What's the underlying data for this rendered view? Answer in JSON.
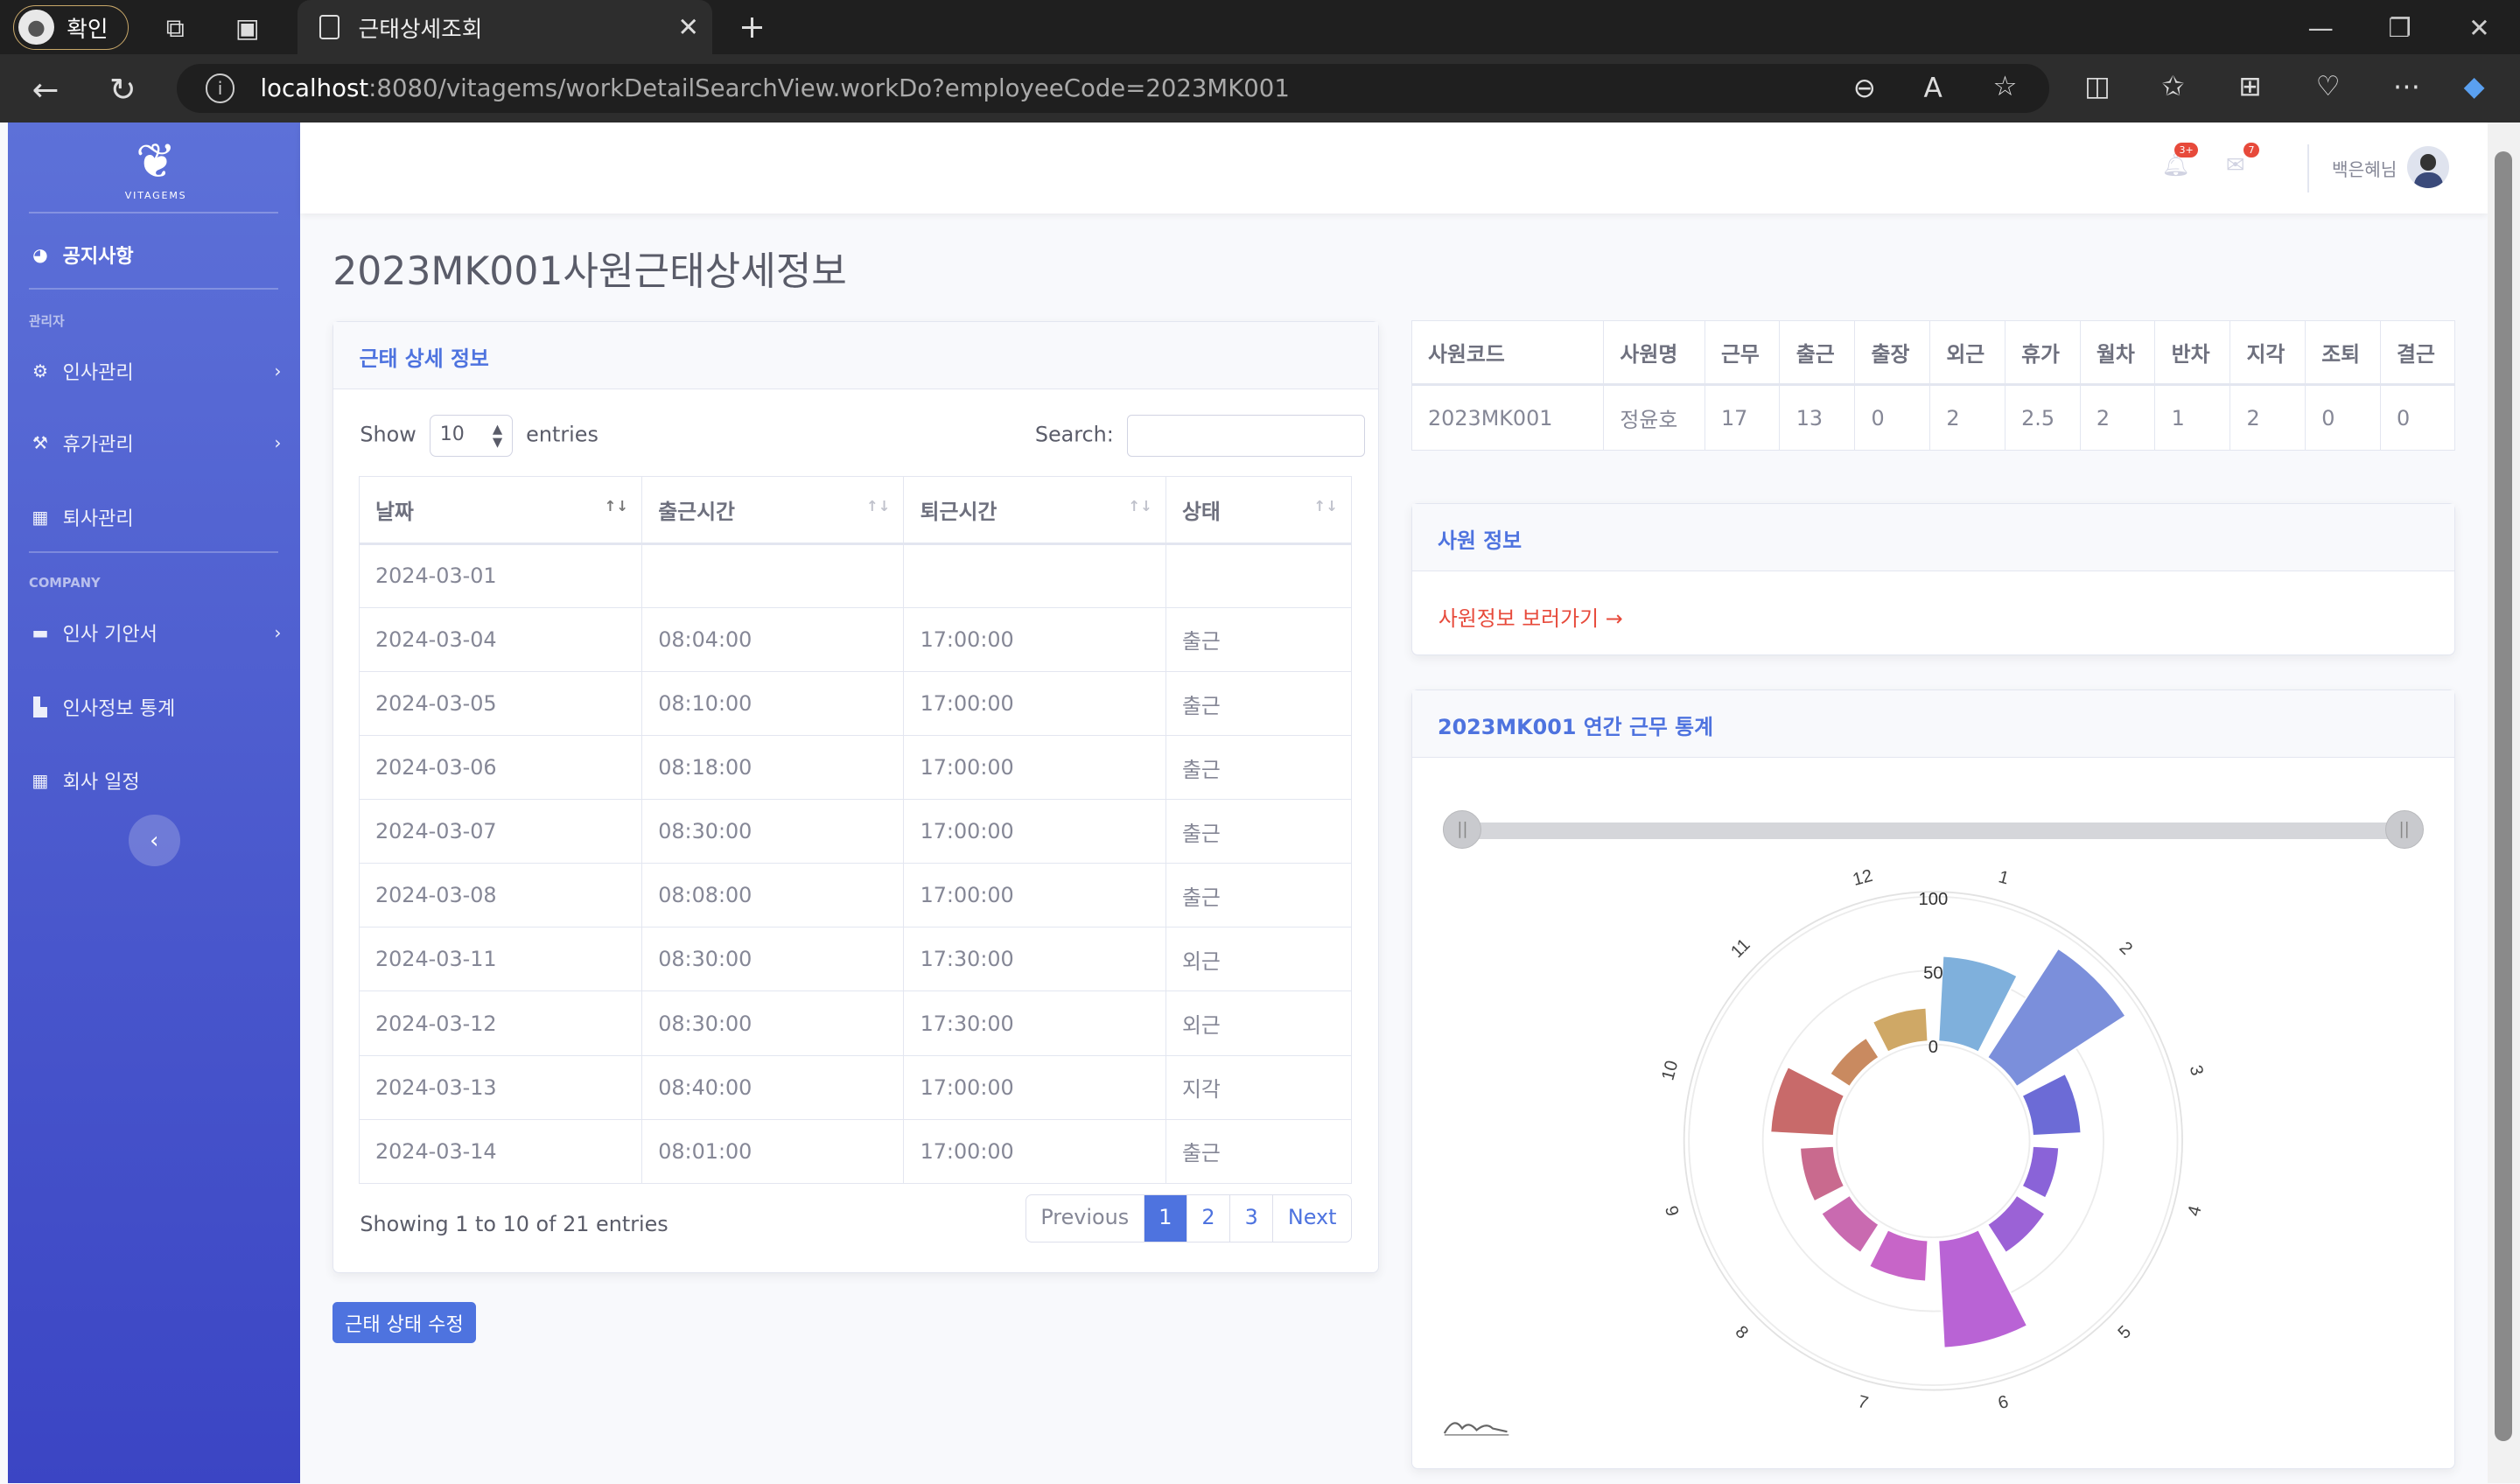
{
  "browser": {
    "profile_label": "확인",
    "tab_title": "근태상세조회",
    "url_host": "localhost",
    "url_rest": ":8080/vitagems/workDetailSearchView.workDo?employeeCode=2023MK001"
  },
  "sidebar": {
    "logo_text": "VITAGEMS",
    "items": [
      {
        "label": "공지사항",
        "icon": "dashboard-icon"
      },
      {
        "label": "인사관리",
        "icon": "gear-icon"
      },
      {
        "label": "휴가관리",
        "icon": "wrench-icon"
      },
      {
        "label": "퇴사관리",
        "icon": "table-icon"
      },
      {
        "label": "인사 기안서",
        "icon": "folder-icon"
      },
      {
        "label": "인사정보 통계",
        "icon": "chart-icon"
      },
      {
        "label": "회사 일정",
        "icon": "table-icon"
      }
    ],
    "section_admin": "관리자",
    "section_company": "COMPANY"
  },
  "topbar": {
    "alerts_badge": "3+",
    "messages_badge": "7",
    "user_name": "백은혜님"
  },
  "page_title": "2023MK001사원근태상세정보",
  "detail_card": {
    "header": "근태 상세 정보",
    "show_label": "Show",
    "entries_value": "10",
    "entries_label": "entries",
    "search_label": "Search:",
    "columns": [
      "날짜",
      "출근시간",
      "퇴근시간",
      "상태"
    ],
    "rows": [
      [
        "2024-03-01",
        "",
        "",
        ""
      ],
      [
        "2024-03-04",
        "08:04:00",
        "17:00:00",
        "출근"
      ],
      [
        "2024-03-05",
        "08:10:00",
        "17:00:00",
        "출근"
      ],
      [
        "2024-03-06",
        "08:18:00",
        "17:00:00",
        "출근"
      ],
      [
        "2024-03-07",
        "08:30:00",
        "17:00:00",
        "출근"
      ],
      [
        "2024-03-08",
        "08:08:00",
        "17:00:00",
        "출근"
      ],
      [
        "2024-03-11",
        "08:30:00",
        "17:30:00",
        "외근"
      ],
      [
        "2024-03-12",
        "08:30:00",
        "17:30:00",
        "외근"
      ],
      [
        "2024-03-13",
        "08:40:00",
        "17:00:00",
        "지각"
      ],
      [
        "2024-03-14",
        "08:01:00",
        "17:00:00",
        "출근"
      ]
    ],
    "info": "Showing 1 to 10 of 21 entries",
    "pager": [
      "Previous",
      "1",
      "2",
      "3",
      "Next"
    ],
    "edit_button": "근태 상태 수정"
  },
  "summary": {
    "columns": [
      "사원코드",
      "사원명",
      "근무",
      "출근",
      "출장",
      "외근",
      "휴가",
      "월차",
      "반차",
      "지각",
      "조퇴",
      "결근"
    ],
    "row": [
      "2023MK001",
      "정윤호",
      "17",
      "13",
      "0",
      "2",
      "2.5",
      "2",
      "1",
      "2",
      "0",
      "0"
    ]
  },
  "employee_card": {
    "header": "사원 정보",
    "link": "사원정보 보러가기 →"
  },
  "stats_card": {
    "header": "2023MK001 연간 근무 통계"
  },
  "chart_data": {
    "type": "bar",
    "polar": true,
    "categories": [
      "1",
      "2",
      "3",
      "4",
      "5",
      "6",
      "7",
      "8",
      "9",
      "10",
      "11",
      "12"
    ],
    "values": [
      60,
      90,
      35,
      20,
      25,
      75,
      30,
      25,
      25,
      45,
      18,
      25
    ],
    "radial_ticks": [
      "0",
      "50",
      "100"
    ],
    "ylim": [
      0,
      100
    ],
    "colors": [
      "#7fb0dc",
      "#7b8fdb",
      "#6c6bd6",
      "#8a63d8",
      "#9b62d6",
      "#b963d5",
      "#c765c8",
      "#c96ab0",
      "#c96a8e",
      "#c86a6a",
      "#c98a60",
      "#cfa866"
    ]
  }
}
